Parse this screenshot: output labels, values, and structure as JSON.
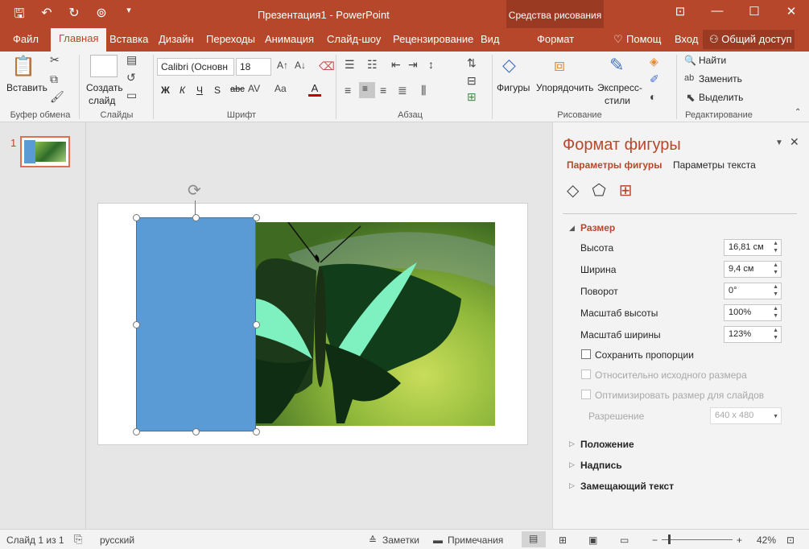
{
  "titlebar": {
    "title": "Презентация1 - PowerPoint",
    "context_group": "Средства рисования",
    "qat": [
      "save-icon",
      "undo-icon",
      "redo-icon",
      "present-icon",
      "customize-icon"
    ],
    "window_controls": [
      "⊡",
      "—",
      "☐",
      "✕"
    ]
  },
  "tabs": {
    "file": "Файл",
    "home": "Главная",
    "insert": "Вставка",
    "design": "Дизайн",
    "transitions": "Переходы",
    "animation": "Анимация",
    "slideshow": "Слайд-шоу",
    "review": "Рецензирование",
    "view": "Вид",
    "format": "Формат",
    "tell_me": "Помощ",
    "signin": "Вход",
    "share": "Общий доступ"
  },
  "ribbon": {
    "paste": "Вставить",
    "new_slide_1": "Создать",
    "new_slide_2": "слайд",
    "font_name": "Calibri (Основн",
    "font_size": "18",
    "bold": "Ж",
    "italic": "К",
    "underline": "Ч",
    "strike": "S",
    "abc": "abc",
    "shapes": "Фигуры",
    "arrange": "Упорядочить",
    "quick_styles_1": "Экспресс-",
    "quick_styles_2": "стили",
    "find": "Найти",
    "replace": "Заменить",
    "select": "Выделить",
    "groups": {
      "clipboard": "Буфер обмена",
      "slides": "Слайды",
      "font": "Шрифт",
      "paragraph": "Абзац",
      "drawing": "Рисование",
      "editing": "Редактирование"
    }
  },
  "thumbnails": {
    "slide_number": "1"
  },
  "pane": {
    "title": "Формат фигуры",
    "tab_shape": "Параметры фигуры",
    "tab_text": "Параметры текста",
    "size_section": "Размер",
    "height_label": "Высота",
    "height_value": "16,81 см",
    "width_label": "Ширина",
    "width_value": "9,4 см",
    "rotation_label": "Поворот",
    "rotation_value": "0°",
    "scale_h_label": "Масштаб высоты",
    "scale_h_value": "100%",
    "scale_w_label": "Масштаб ширины",
    "scale_w_value": "123%",
    "lock_ratio": "Сохранить пропорции",
    "relative_orig": "Относительно исходного размера",
    "best_scale": "Оптимизировать размер для слайдов",
    "resolution_label": "Разрешение",
    "resolution_value": "640 x 480",
    "position_section": "Положение",
    "textbox_section": "Надпись",
    "alt_text_section": "Замещающий текст"
  },
  "status": {
    "slide_info": "Слайд 1 из 1",
    "language": "русский",
    "notes": "Заметки",
    "comments": "Примечания",
    "zoom": "42%",
    "zoom_minus": "−",
    "zoom_plus": "+"
  },
  "colors": {
    "accent": "#b7472a",
    "shape_fill": "#5b9bd5"
  }
}
